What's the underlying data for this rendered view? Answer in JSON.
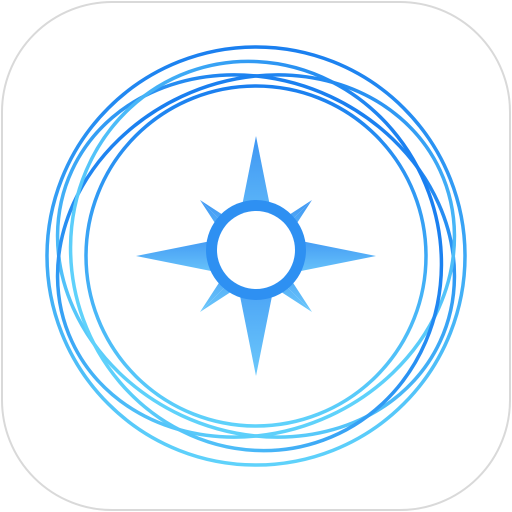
{
  "icon": {
    "name": "compass-app-icon",
    "shape": "rounded-square",
    "colors": {
      "tile": "#ffffff",
      "tile_border": "#d9d9d9",
      "gradient_top": "#1a7ff0",
      "gradient_bottom": "#5fd2fb",
      "star_top": "#3f96f3",
      "star_bottom": "#6cc8fb",
      "hub_ring": "#2e90f2"
    },
    "orbits": 5,
    "compass_points": 8
  }
}
